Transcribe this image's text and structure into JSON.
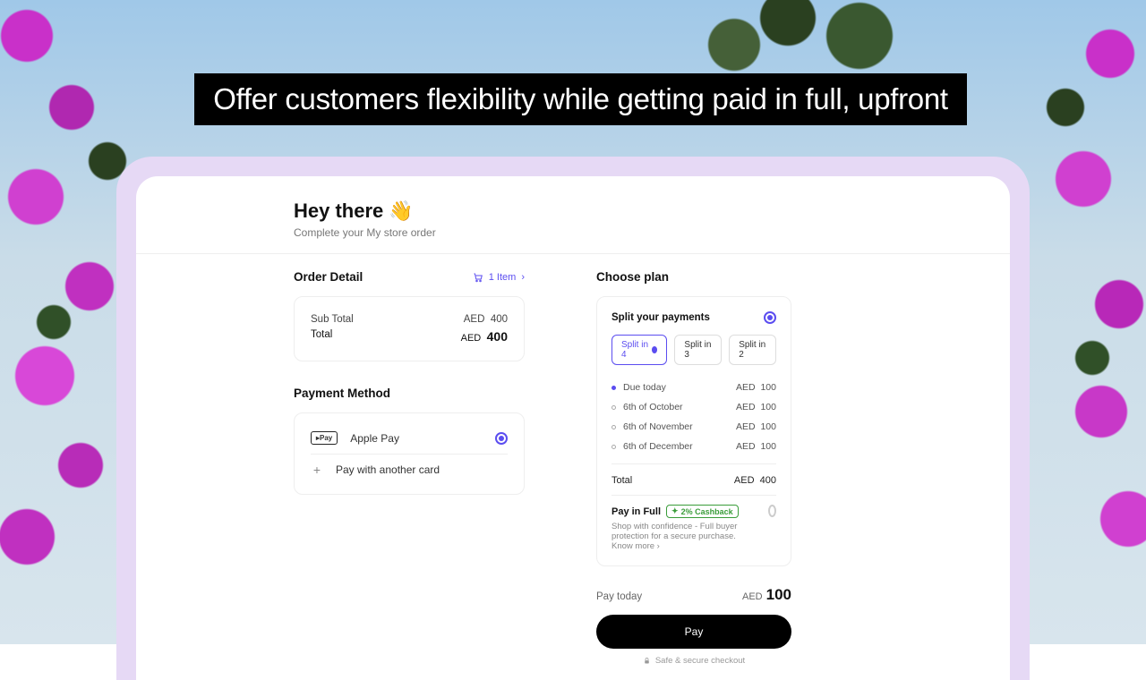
{
  "banner": "Offer customers flexibility while getting paid in full, upfront",
  "header": {
    "greeting": "Hey there 👋",
    "subtitle": "Complete your My store order"
  },
  "order": {
    "title": "Order Detail",
    "items_link": "1 Item",
    "subtotal_label": "Sub Total",
    "subtotal_currency": "AED",
    "subtotal_value": "400",
    "total_label": "Total",
    "total_currency": "AED",
    "total_value": "400"
  },
  "payment": {
    "title": "Payment Method",
    "apple_pay": "Apple Pay",
    "apple_badge": "▸Pay",
    "other_card": "Pay with another card"
  },
  "plan": {
    "title": "Choose plan",
    "split_title": "Split your payments",
    "tabs": [
      "Split in 4",
      "Split in 3",
      "Split in 2"
    ],
    "schedule": [
      {
        "label": "Due today",
        "currency": "AED",
        "amount": "100",
        "active": true
      },
      {
        "label": "6th of October",
        "currency": "AED",
        "amount": "100",
        "active": false
      },
      {
        "label": "6th of November",
        "currency": "AED",
        "amount": "100",
        "active": false
      },
      {
        "label": "6th of December",
        "currency": "AED",
        "amount": "100",
        "active": false
      }
    ],
    "total_label": "Total",
    "total_currency": "AED",
    "total_value": "400",
    "pif_title": "Pay in Full",
    "cashback": "2% Cashback",
    "pif_desc": "Shop with confidence - Full buyer protection for a secure purchase. ",
    "know_more": "Know more ›"
  },
  "pay_today": {
    "label": "Pay today",
    "currency": "AED",
    "value": "100"
  },
  "pay_button": "Pay",
  "secure": "Safe & secure checkout"
}
